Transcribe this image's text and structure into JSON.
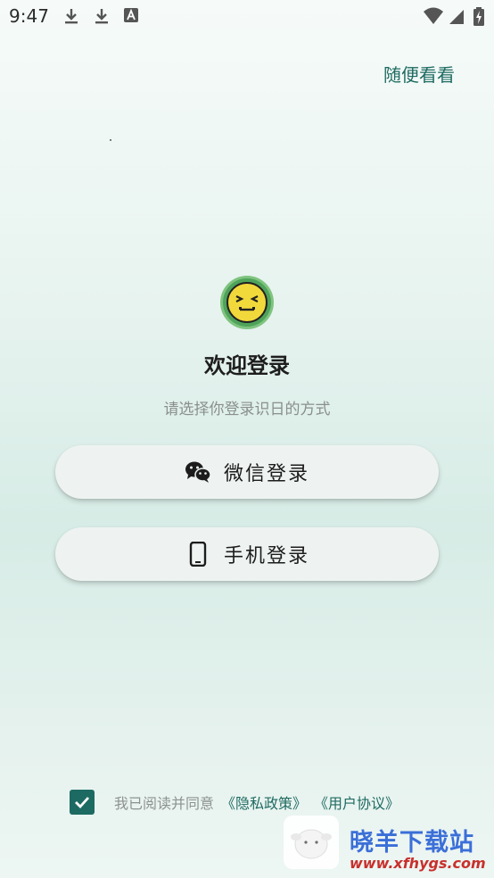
{
  "status_bar": {
    "time": "9:47",
    "left_icons": [
      "download-icon",
      "download-icon",
      "font-a-icon"
    ],
    "right_icons": [
      "wifi-icon",
      "cellular-signal-icon",
      "battery-charging-icon"
    ]
  },
  "header": {
    "browse_label": "随便看看"
  },
  "welcome": {
    "avatar_icon": "pixel-smiley-face-icon",
    "title": "欢迎登录",
    "subtitle": "请选择你登录识日的方式"
  },
  "login_options": [
    {
      "label": "微信登录",
      "icon": "wechat-icon"
    },
    {
      "label": "手机登录",
      "icon": "mobile-phone-icon"
    }
  ],
  "agreement": {
    "checked": true,
    "text": "我已阅读并同意",
    "privacy_link": "《隐私政策》",
    "user_agreement_link": "《用户协议》"
  },
  "watermark": {
    "title": "晓羊下载站",
    "url": "www.xfhygs.com"
  },
  "colors": {
    "accent": "#1f6b62",
    "checkbox": "#1d6a62",
    "button_bg": "#eef3f1",
    "watermark_title": "#3b6fd8",
    "watermark_url": "#c8302c"
  }
}
